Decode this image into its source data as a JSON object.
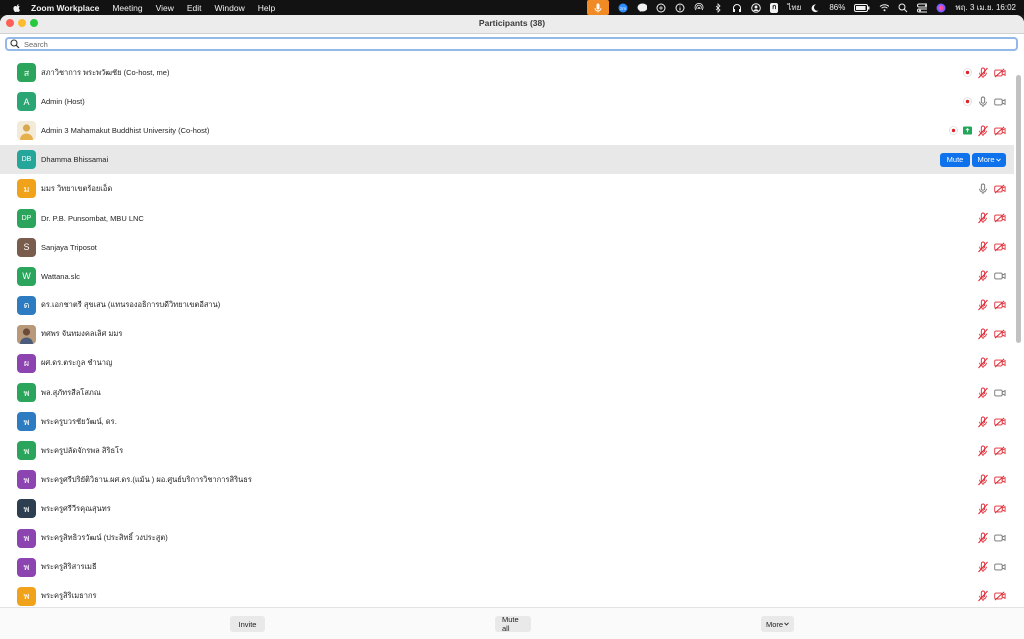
{
  "menubar": {
    "app_name": "Zoom Workplace",
    "menus": [
      "Meeting",
      "View",
      "Edit",
      "Window",
      "Help"
    ],
    "input_source": "ไทย",
    "input_badge": "ก",
    "battery": "86%",
    "date_time": "พฤ. 3 เม.ย. 16:02"
  },
  "window": {
    "title": "Participants (38)"
  },
  "search": {
    "placeholder": "Search"
  },
  "selected_actions": {
    "mute_label": "Mute",
    "more_label": "More"
  },
  "participants": [
    {
      "name": "สภาวิชาการ พระพวัฒชัย (Co-host, me)",
      "initials": "ส",
      "color": "#2aa55b",
      "icons": [
        "record",
        "mic-off",
        "video-off"
      ]
    },
    {
      "name": "Admin (Host)",
      "initials": "A",
      "color": "#2aa573",
      "icons": [
        "record",
        "mic-on",
        "video-on"
      ]
    },
    {
      "name": "Admin 3 Mahamakut Buddhist University (Co-host)",
      "initials": "",
      "color": "#ffffff",
      "photo": true,
      "icons": [
        "record",
        "share",
        "mic-off",
        "video-off"
      ]
    },
    {
      "name": "Dhamma Bhissamai",
      "initials": "DB",
      "color": "#24a69a",
      "selected": true,
      "icons": []
    },
    {
      "name": "มมร วิทยาเขตร้อยเอ็ด",
      "initials": "ม",
      "color": "#f1a21b",
      "icons": [
        "mic-on",
        "video-off"
      ]
    },
    {
      "name": "Dr. P.B. Punsombat, MBU LNC",
      "initials": "DP",
      "color": "#2aa55b",
      "icons": [
        "mic-off",
        "video-off"
      ]
    },
    {
      "name": "Sanjaya Triposot",
      "initials": "S",
      "color": "#7a5c4c",
      "icons": [
        "mic-off",
        "video-off"
      ]
    },
    {
      "name": "Wattana.slc",
      "initials": "W",
      "color": "#2aa55b",
      "icons": [
        "mic-off",
        "video-on"
      ]
    },
    {
      "name": "ดร.เอกชาตรี สุขเสน (แทนรองอธิการบดีวิทยาเขตอีสาน)",
      "initials": "ด",
      "color": "#2d7bc0",
      "icons": [
        "mic-off",
        "video-off"
      ]
    },
    {
      "name": "ทศพร จันทมงคลเลิศ มมร",
      "initials": "",
      "color": "#c9a47a",
      "photo": true,
      "icons": [
        "mic-off",
        "video-off"
      ]
    },
    {
      "name": "ผศ.ดร.ตระกูล ชำนาญ",
      "initials": "ผ",
      "color": "#8b44b0",
      "icons": [
        "mic-off",
        "video-off"
      ]
    },
    {
      "name": "พล.สุภัทรสีลโสภณ",
      "initials": "พ",
      "color": "#2aa55b",
      "icons": [
        "mic-off",
        "video-on"
      ]
    },
    {
      "name": "พระครูบวรชัยวัฒน์, ดร.",
      "initials": "พ",
      "color": "#2d7bc0",
      "icons": [
        "mic-off",
        "video-off"
      ]
    },
    {
      "name": "พระครูปลัดจักรพล สิริธโร",
      "initials": "พ",
      "color": "#2aa55b",
      "icons": [
        "mic-off",
        "video-off"
      ]
    },
    {
      "name": "พระครูศรีปริยัติวิธาน.ผศ.ดร.(แม้น ) ผอ.ศูนย์บริการวิชาการสิรินธร",
      "initials": "พ",
      "color": "#8b44b0",
      "icons": [
        "mic-off",
        "video-off"
      ]
    },
    {
      "name": "พระครูศรีวีรคุณสุนทร",
      "initials": "พ",
      "color": "#2c3e50",
      "icons": [
        "mic-off",
        "video-off"
      ]
    },
    {
      "name": "พระครูสิทธิวรวัฒน์ (ประสิทธิ์ วงประสูต)",
      "initials": "พ",
      "color": "#8b44b0",
      "icons": [
        "mic-off",
        "video-on"
      ]
    },
    {
      "name": "พระครูสิริสารเมธี",
      "initials": "พ",
      "color": "#8b44b0",
      "icons": [
        "mic-off",
        "video-on"
      ]
    },
    {
      "name": "พระครูสิริเมธากร",
      "initials": "พ",
      "color": "#f1a21b",
      "icons": [
        "mic-off",
        "video-off"
      ]
    }
  ],
  "bottom": {
    "invite_label": "Invite",
    "mute_all_label": "Mute all",
    "more_label": "More"
  }
}
